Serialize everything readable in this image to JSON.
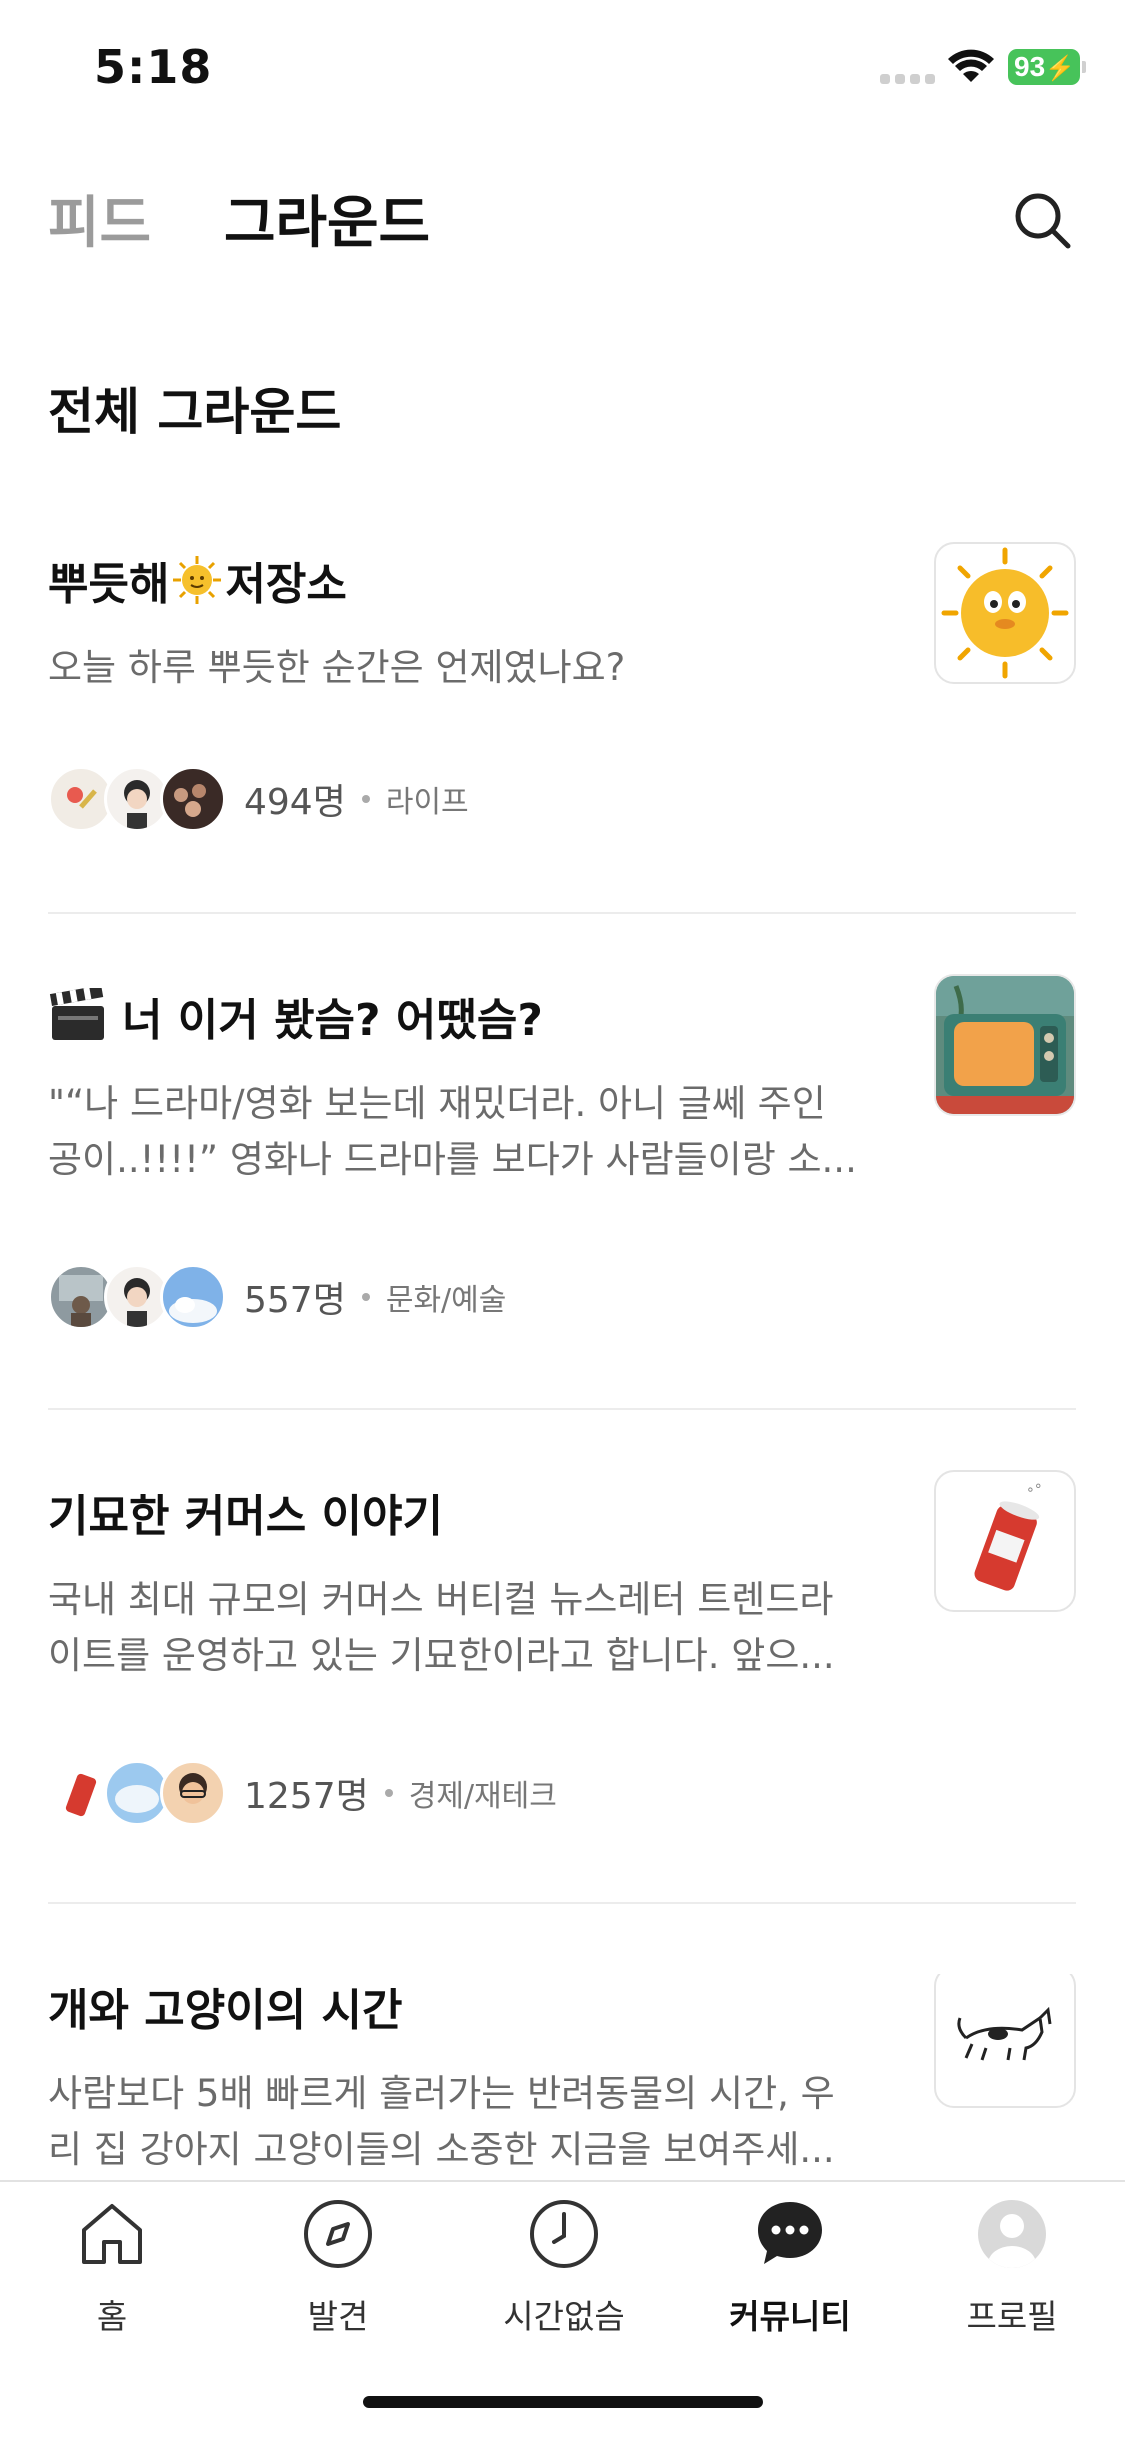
{
  "status_bar": {
    "time": "5:18",
    "battery": "93"
  },
  "header": {
    "tab_feed": "피드",
    "tab_ground": "그라운드"
  },
  "section_title": "전체 그라운드",
  "cards": [
    {
      "title_pre": "뿌듯해",
      "title_emoji": "sun-emoji",
      "title_post": "저장소",
      "desc_lines": [
        "오늘 하루 뿌듯한 순간은 언제였나요?"
      ],
      "members": "494명",
      "category": "라이프"
    },
    {
      "title_pre": "",
      "title_emoji": "clapper-emoji",
      "title_post": "너 이거 봤슴? 어땠슴?",
      "desc_lines": [
        "\"“나 드라마/영화 보는데 재밌더라. 아니 글쎄 주인",
        "공이..!!!!” 영화나 드라마를 보다가 사람들이랑 소..."
      ],
      "members": "557명",
      "category": "문화/예술"
    },
    {
      "title_pre": "",
      "title_emoji": "",
      "title_post": "기묘한 커머스 이야기",
      "desc_lines": [
        "국내 최대 규모의 커머스 버티컬 뉴스레터 트렌드라",
        "이트를 운영하고 있는 기묘한이라고 합니다. 앞으..."
      ],
      "members": "1257명",
      "category": "경제/재테크"
    },
    {
      "title_pre": "",
      "title_emoji": "",
      "title_post": "개와 고양이의 시간",
      "desc_lines": [
        "사람보다 5배 빠르게 흘러가는 반려동물의 시간, 우",
        "리 집 강아지 고양이들의 소중한 지금을 보여주세..."
      ],
      "members": "",
      "category": ""
    }
  ],
  "tabbar": {
    "items": [
      {
        "label": "홈",
        "icon": "home-icon"
      },
      {
        "label": "발견",
        "icon": "compass-icon"
      },
      {
        "label": "시간없슴",
        "icon": "clock-icon"
      },
      {
        "label": "커뮤니티",
        "icon": "chat-bubble-icon"
      },
      {
        "label": "프로필",
        "icon": "profile-icon"
      }
    ],
    "active": "커뮤니티"
  }
}
